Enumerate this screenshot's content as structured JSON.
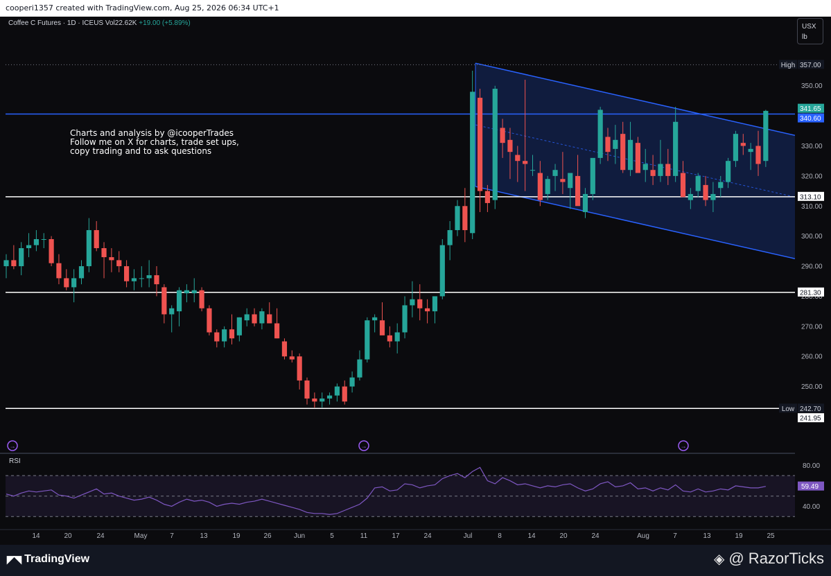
{
  "header": {
    "attribution": "cooperi1357 created with TradingView.com, Aug 25, 2026 06:34 UTC+1"
  },
  "legend": {
    "symbol": "Coffee C Futures · 1D · ICEUS",
    "vol_label": "Vol",
    "vol_value": "22.62K",
    "change": "+19.00 (+5.89%)"
  },
  "annotation": "Charts and analysis by @icooperTrades\nFollow me on X for charts, trade set ups,\ncopy trading and to ask questions",
  "unit": {
    "currency": "USX",
    "unit": "lb"
  },
  "price_labels": {
    "high_tag": "High",
    "high": "357.00",
    "last": "341.65",
    "level_blue": "340.60",
    "level_313": "313.10",
    "level_281": "281.30",
    "low_tag": "Low",
    "low": "242.70",
    "low2": "241.95"
  },
  "rsi": {
    "label": "RSI",
    "value": "59.49",
    "ticks": [
      "80.00",
      "40.00"
    ]
  },
  "footer": {
    "brand": "TradingView",
    "watermark": "@ RazorTicks"
  },
  "colors": {
    "up": "#26a69a",
    "down": "#ef5350",
    "channel": "#2962ff",
    "rsi_line": "#7e57c2"
  },
  "chart_data": {
    "type": "candlestick",
    "y_ticks": [
      350,
      340,
      330,
      320,
      310,
      300,
      290,
      280,
      270,
      260,
      250
    ],
    "y_tick_labels": [
      "350.00",
      "340.00",
      "330.00",
      "320.00",
      "310.00",
      "300.00",
      "290.00",
      "280.00",
      "270.00",
      "260.00",
      "250.00"
    ],
    "ylim": [
      237,
      361
    ],
    "x_tick_labels": [
      "14",
      "20",
      "24",
      "May",
      "7",
      "13",
      "19",
      "26",
      "Jun",
      "5",
      "11",
      "17",
      "24",
      "Jul",
      "8",
      "14",
      "20",
      "24",
      "Aug",
      "7",
      "13",
      "19",
      "25"
    ],
    "horizontal_levels": [
      340.6,
      313.1,
      281.3,
      242.7
    ],
    "candles": [
      [
        290,
        294,
        286,
        292
      ],
      [
        292,
        297,
        289,
        290
      ],
      [
        290,
        298,
        287,
        296
      ],
      [
        296,
        301,
        293,
        297
      ],
      [
        297,
        302,
        295,
        299
      ],
      [
        299,
        301,
        296,
        299
      ],
      [
        299,
        300,
        290,
        291
      ],
      [
        291,
        294,
        284,
        286
      ],
      [
        286,
        289,
        282,
        283
      ],
      [
        283,
        289,
        278,
        286
      ],
      [
        286,
        292,
        284,
        290
      ],
      [
        290,
        306,
        288,
        302
      ],
      [
        302,
        305,
        295,
        296
      ],
      [
        296,
        298,
        286,
        293
      ],
      [
        293,
        296,
        288,
        292
      ],
      [
        292,
        295,
        288,
        290
      ],
      [
        290,
        292,
        283,
        285
      ],
      [
        285,
        289,
        282,
        286
      ],
      [
        286,
        290,
        283,
        286
      ],
      [
        286,
        292,
        283,
        287
      ],
      [
        287,
        290,
        280,
        284
      ],
      [
        283,
        284,
        271,
        274
      ],
      [
        274,
        277,
        268,
        276
      ],
      [
        275,
        283,
        270,
        282
      ],
      [
        281,
        284,
        278,
        282
      ],
      [
        281,
        286,
        278,
        282
      ],
      [
        282,
        283,
        275,
        276
      ],
      [
        276,
        277,
        267,
        268
      ],
      [
        268,
        269,
        263,
        265
      ],
      [
        265,
        270,
        263,
        269
      ],
      [
        269,
        274,
        264,
        266
      ],
      [
        267,
        273,
        265,
        273
      ],
      [
        272,
        276,
        270,
        274
      ],
      [
        274,
        276,
        270,
        271
      ],
      [
        271,
        276,
        269,
        275
      ],
      [
        274,
        278,
        272,
        271
      ],
      [
        271,
        276,
        266,
        266
      ],
      [
        265,
        266,
        259,
        260
      ],
      [
        260,
        262,
        258,
        259
      ],
      [
        260,
        261,
        249,
        252
      ],
      [
        252,
        253,
        244,
        246
      ],
      [
        246,
        248,
        243,
        245
      ],
      [
        245,
        248,
        243,
        246
      ],
      [
        246,
        248,
        244,
        247
      ],
      [
        247,
        251,
        245,
        250
      ],
      [
        250,
        252,
        244,
        245
      ],
      [
        250,
        255,
        248,
        253
      ],
      [
        253,
        262,
        252,
        259
      ],
      [
        259,
        273,
        258,
        272
      ],
      [
        272,
        274,
        268,
        273
      ],
      [
        272,
        278,
        270,
        267
      ],
      [
        267,
        270,
        263,
        265
      ],
      [
        265,
        271,
        261,
        268
      ],
      [
        268,
        280,
        266,
        277
      ],
      [
        277,
        285,
        273,
        279
      ],
      [
        279,
        284,
        272,
        276
      ],
      [
        276,
        279,
        271,
        275
      ],
      [
        275,
        280,
        271,
        280
      ],
      [
        280,
        299,
        279,
        297
      ],
      [
        297,
        305,
        292,
        302
      ],
      [
        302,
        312,
        300,
        310
      ],
      [
        310,
        316,
        298,
        302
      ],
      [
        301,
        355,
        299,
        348
      ],
      [
        346,
        349,
        308,
        315
      ],
      [
        315,
        317,
        308,
        311
      ],
      [
        312,
        350,
        309,
        349
      ],
      [
        336,
        339,
        326,
        331
      ],
      [
        332,
        336,
        319,
        328
      ],
      [
        327,
        330,
        318,
        325
      ],
      [
        325,
        352,
        315,
        324
      ],
      [
        322,
        327,
        320,
        322
      ],
      [
        321,
        325,
        310,
        312
      ],
      [
        314,
        320,
        312,
        319
      ],
      [
        320,
        324,
        315,
        322
      ],
      [
        319,
        328,
        314,
        318
      ],
      [
        316,
        320,
        309,
        321
      ],
      [
        320,
        327,
        312,
        310
      ],
      [
        308,
        316,
        306,
        314
      ],
      [
        314,
        325,
        312,
        326
      ],
      [
        326,
        343,
        324,
        342
      ],
      [
        333,
        336,
        325,
        328
      ],
      [
        329,
        337,
        324,
        332
      ],
      [
        334,
        338,
        321,
        322
      ],
      [
        322,
        338,
        320,
        332
      ],
      [
        331,
        333,
        322,
        321
      ],
      [
        322,
        329,
        318,
        324
      ],
      [
        322,
        327,
        317,
        320
      ],
      [
        320,
        332,
        318,
        324
      ],
      [
        324,
        329,
        317,
        320
      ],
      [
        320,
        343,
        318,
        338
      ],
      [
        321,
        325,
        313,
        313
      ],
      [
        312,
        316,
        309,
        314
      ],
      [
        315,
        321,
        313,
        320
      ],
      [
        317,
        320,
        310,
        312
      ],
      [
        312,
        318,
        308,
        314
      ],
      [
        316,
        320,
        313,
        318
      ],
      [
        318,
        326,
        316,
        325
      ],
      [
        325,
        335,
        323,
        334
      ],
      [
        331,
        334,
        327,
        330
      ],
      [
        328,
        331,
        322,
        329
      ],
      [
        330,
        335,
        320,
        324
      ],
      [
        325,
        342,
        323,
        341.65
      ]
    ],
    "channel_upper": [
      [
        358,
        335
      ],
      [
        357,
        332
      ]
    ],
    "rsi_values": [
      52,
      50,
      53,
      55,
      54,
      55,
      56,
      51,
      50,
      48,
      51,
      54,
      57,
      52,
      53,
      50,
      48,
      46,
      47,
      49,
      46,
      42,
      40,
      44,
      47,
      45,
      46,
      44,
      40,
      42,
      43,
      42,
      44,
      45,
      47,
      45,
      43,
      41,
      39,
      37,
      34,
      33,
      33,
      32,
      33,
      36,
      39,
      42,
      48,
      58,
      59,
      55,
      56,
      62,
      61,
      58,
      60,
      61,
      67,
      70,
      72,
      68,
      74,
      78,
      65,
      62,
      68,
      65,
      61,
      62,
      60,
      58,
      60,
      59,
      61,
      62,
      58,
      55,
      57,
      62,
      64,
      59,
      60,
      63,
      57,
      58,
      55,
      58,
      56,
      61,
      55,
      54,
      57,
      54,
      55,
      57,
      56,
      60,
      59,
      58,
      58,
      59.49
    ]
  }
}
